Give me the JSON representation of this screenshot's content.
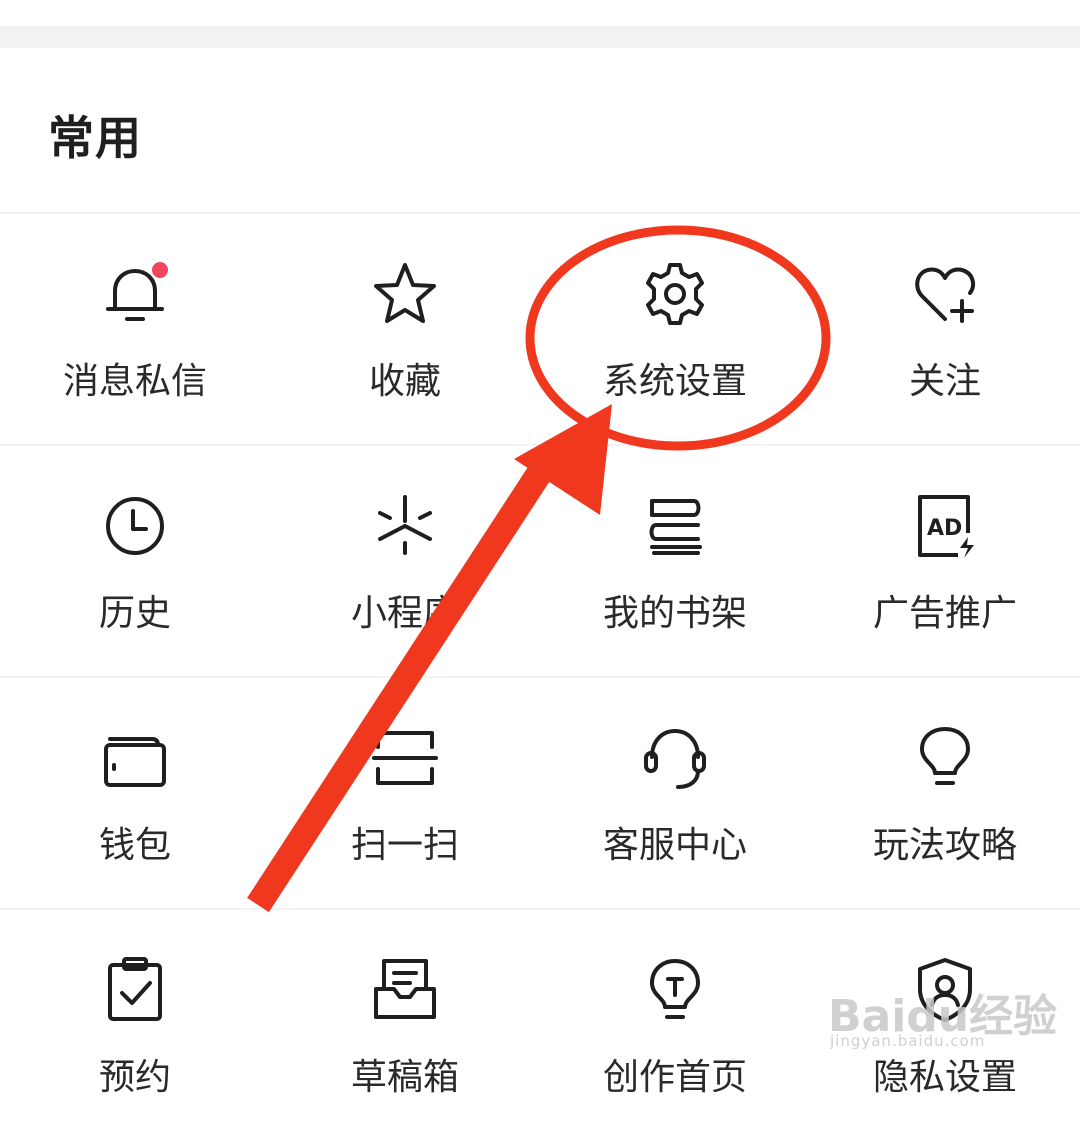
{
  "section": {
    "title": "常用"
  },
  "rows": [
    [
      {
        "label": "消息私信",
        "icon": "bell-icon",
        "badge": true
      },
      {
        "label": "收藏",
        "icon": "star-icon"
      },
      {
        "label": "系统设置",
        "icon": "gear-icon"
      },
      {
        "label": "关注",
        "icon": "heart-plus-icon"
      }
    ],
    [
      {
        "label": "历史",
        "icon": "clock-icon"
      },
      {
        "label": "小程序",
        "icon": "mini-program-icon"
      },
      {
        "label": "我的书架",
        "icon": "bookshelf-icon"
      },
      {
        "label": "广告推广",
        "icon": "ad-icon"
      }
    ],
    [
      {
        "label": "钱包",
        "icon": "wallet-icon"
      },
      {
        "label": "扫一扫",
        "icon": "scan-icon"
      },
      {
        "label": "客服中心",
        "icon": "headset-icon"
      },
      {
        "label": "玩法攻略",
        "icon": "lightbulb-icon"
      }
    ],
    [
      {
        "label": "预约",
        "icon": "clipboard-check-icon"
      },
      {
        "label": "草稿箱",
        "icon": "draft-box-icon"
      },
      {
        "label": "创作首页",
        "icon": "creator-bulb-icon"
      },
      {
        "label": "隐私设置",
        "icon": "privacy-shield-icon"
      }
    ]
  ],
  "annotation": {
    "color": "#f0381f",
    "target": "系统设置"
  },
  "watermark": {
    "text": "Baidu经验",
    "sub": "jingyan.baidu.com"
  }
}
